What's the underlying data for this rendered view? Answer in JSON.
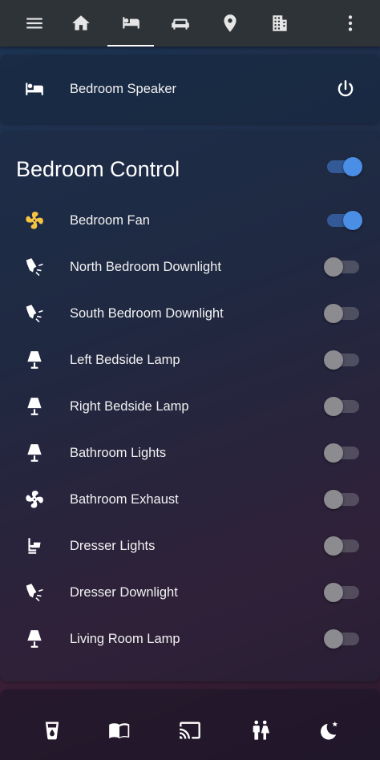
{
  "colors": {
    "accent": "#4a8ee6",
    "fan_active": "#f4c542",
    "topbar": "#2e3338"
  },
  "topbar": {
    "icons": [
      "menu-icon",
      "home-icon",
      "bed-icon",
      "sofa-icon",
      "map-marker-icon",
      "office-building-icon",
      "more-vert-icon"
    ],
    "active_tab": "bed-icon"
  },
  "speaker": {
    "label": "Bedroom Speaker",
    "icon": "bed-icon",
    "action_icon": "power-icon"
  },
  "control": {
    "title": "Bedroom Control",
    "master_on": true,
    "items": [
      {
        "label": "Bedroom Fan",
        "icon": "fan-icon",
        "on": true
      },
      {
        "label": "North Bedroom Downlight",
        "icon": "spotlight-icon",
        "on": false
      },
      {
        "label": "South Bedroom Downlight",
        "icon": "spotlight-icon",
        "on": false
      },
      {
        "label": "Left Bedside Lamp",
        "icon": "lamp-icon",
        "on": false
      },
      {
        "label": "Right Bedside Lamp",
        "icon": "lamp-icon",
        "on": false
      },
      {
        "label": "Bathroom Lights",
        "icon": "lamp-icon",
        "on": false
      },
      {
        "label": "Bathroom Exhaust",
        "icon": "fan-icon",
        "on": false
      },
      {
        "label": "Dresser Lights",
        "icon": "desk-lamp-icon",
        "on": false
      },
      {
        "label": "Dresser Downlight",
        "icon": "spotlight-icon",
        "on": false
      },
      {
        "label": "Living Room Lamp",
        "icon": "lamp-icon",
        "on": false
      }
    ]
  },
  "bottom_bar": {
    "icons": [
      "cup-water-icon",
      "book-open-icon",
      "cast-icon",
      "human-male-female-icon",
      "weather-night-icon"
    ]
  }
}
